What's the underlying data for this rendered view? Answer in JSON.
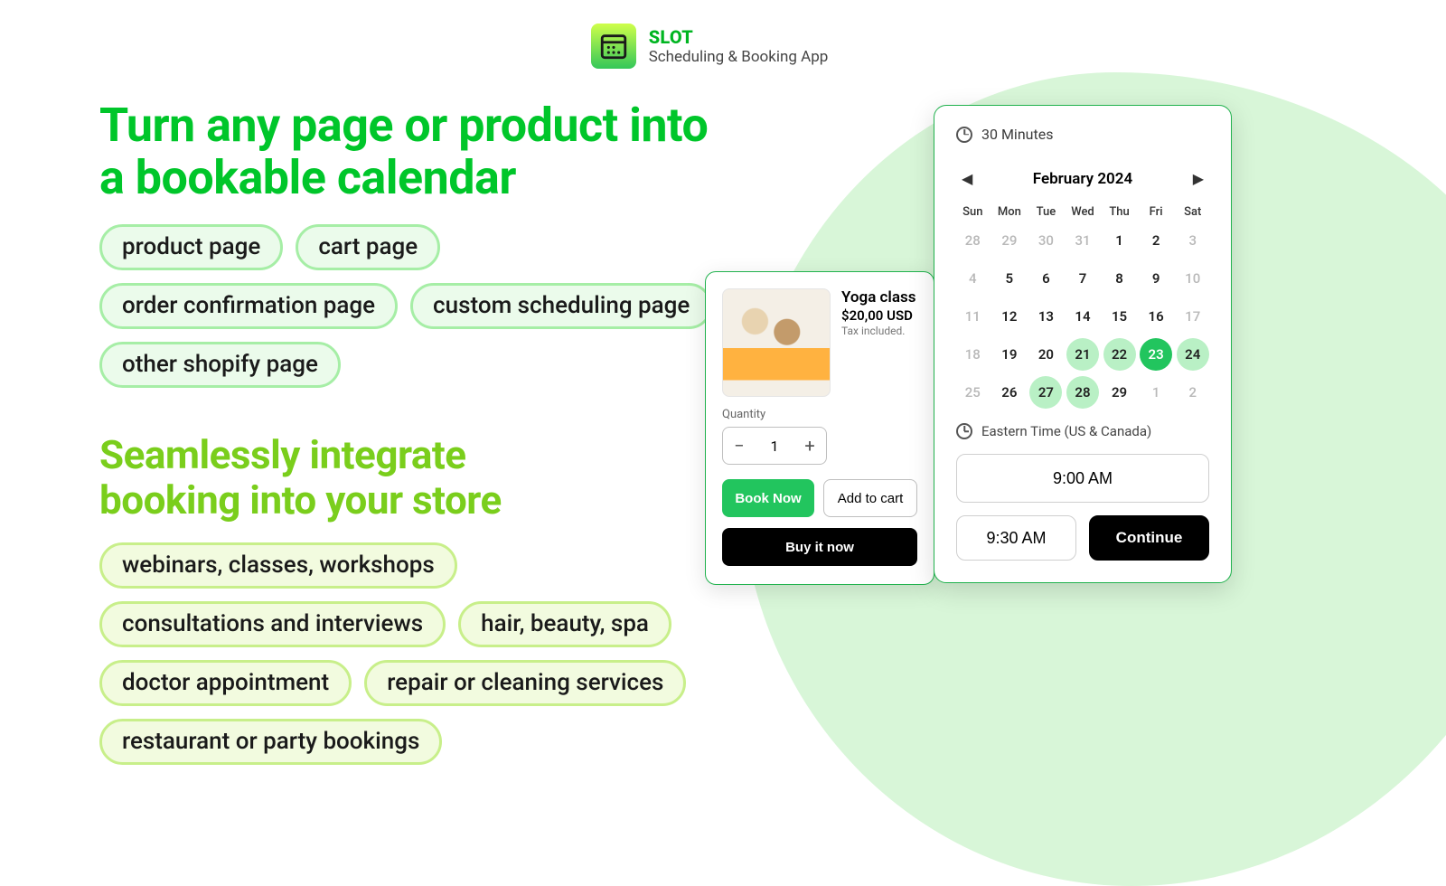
{
  "app": {
    "name": "SLOT",
    "tagline": "Scheduling & Booking App"
  },
  "headline1_l1": "Turn any page or product into",
  "headline1_l2": "a bookable calendar",
  "pills1": [
    "product page",
    "cart page",
    "order confirmation page",
    "custom scheduling page",
    "other shopify page"
  ],
  "headline2_l1": "Seamlessly integrate",
  "headline2_l2": "booking into your store",
  "pills2": [
    "webinars, classes, workshops",
    "consultations and interviews",
    "hair, beauty, spa",
    "doctor appointment",
    "repair or cleaning services",
    "restaurant or party bookings"
  ],
  "product": {
    "title": "Yoga class",
    "price": "$20,00 USD",
    "tax": "Tax included.",
    "qty_label": "Quantity",
    "qty": "1",
    "book": "Book Now",
    "add": "Add to cart",
    "buy": "Buy it now"
  },
  "calendar": {
    "duration": "30 Minutes",
    "month": "February 2024",
    "dows": [
      "Sun",
      "Mon",
      "Tue",
      "Wed",
      "Thu",
      "Fri",
      "Sat"
    ],
    "cells": [
      {
        "n": "28",
        "muted": true
      },
      {
        "n": "29",
        "muted": true
      },
      {
        "n": "30",
        "muted": true
      },
      {
        "n": "31",
        "muted": true
      },
      {
        "n": "1"
      },
      {
        "n": "2"
      },
      {
        "n": "3",
        "muted": true
      },
      {
        "n": "4",
        "muted": true
      },
      {
        "n": "5"
      },
      {
        "n": "6"
      },
      {
        "n": "7"
      },
      {
        "n": "8"
      },
      {
        "n": "9"
      },
      {
        "n": "10",
        "muted": true
      },
      {
        "n": "11",
        "muted": true
      },
      {
        "n": "12"
      },
      {
        "n": "13"
      },
      {
        "n": "14"
      },
      {
        "n": "15"
      },
      {
        "n": "16"
      },
      {
        "n": "17",
        "muted": true
      },
      {
        "n": "18",
        "muted": true
      },
      {
        "n": "19"
      },
      {
        "n": "20"
      },
      {
        "n": "21",
        "avail": true
      },
      {
        "n": "22",
        "avail": true
      },
      {
        "n": "23",
        "selected": true
      },
      {
        "n": "24",
        "avail": true
      },
      {
        "n": "25",
        "muted": true
      },
      {
        "n": "26"
      },
      {
        "n": "27",
        "avail": true
      },
      {
        "n": "28",
        "avail": true
      },
      {
        "n": "29"
      },
      {
        "n": "1",
        "muted": true
      },
      {
        "n": "2",
        "muted": true
      }
    ],
    "tz": "Eastern Time (US & Canada)",
    "slot1": "9:00 AM",
    "slot2": "9:30 AM",
    "continue": "Continue"
  }
}
